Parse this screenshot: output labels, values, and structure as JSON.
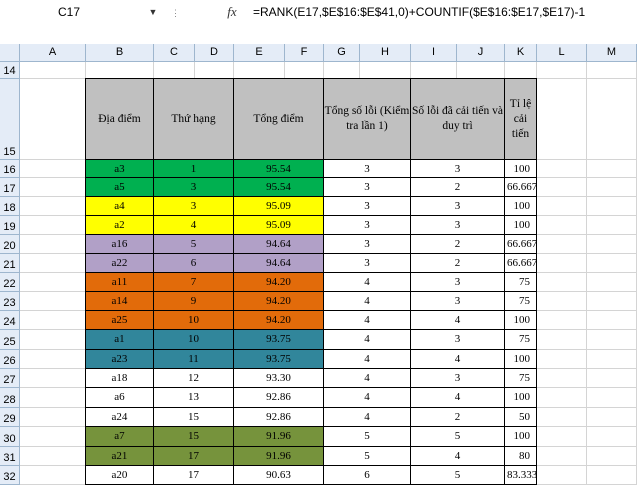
{
  "formula_bar": {
    "name_box": "C17",
    "fx_label": "fx",
    "formula": "=RANK(E17,$E$16:$E$41,0)+COUNTIF($E$16:$E17,$E17)-1"
  },
  "columns": [
    "A",
    "B",
    "C",
    "D",
    "E",
    "F",
    "G",
    "H",
    "I",
    "J",
    "K",
    "L",
    "M"
  ],
  "row_numbers": [
    "14",
    "15",
    "16",
    "17",
    "18",
    "19",
    "20",
    "21",
    "22",
    "23",
    "24",
    "25",
    "26",
    "27",
    "28",
    "29",
    "30",
    "31",
    "32"
  ],
  "table": {
    "headers": [
      "Địa điểm",
      "Thứ hạng",
      "Tổng điểm",
      "Tổng số lỗi (Kiểm tra lần 1)",
      "Số lỗi đã cải tiến và duy trì",
      "Tỉ lệ cải tiến"
    ],
    "rows": [
      {
        "location": "a3",
        "rank": "1",
        "score": "95.54",
        "errors": "3",
        "improved": "3",
        "rate": "100",
        "rate_align": "right",
        "color": "#00b050"
      },
      {
        "location": "a5",
        "rank": "3",
        "score": "95.54",
        "errors": "3",
        "improved": "2",
        "rate": "66.667",
        "rate_align": "left",
        "color": "#00b050"
      },
      {
        "location": "a4",
        "rank": "3",
        "score": "95.09",
        "errors": "3",
        "improved": "3",
        "rate": "100",
        "rate_align": "right",
        "color": "#ffff00"
      },
      {
        "location": "a2",
        "rank": "4",
        "score": "95.09",
        "errors": "3",
        "improved": "3",
        "rate": "100",
        "rate_align": "right",
        "color": "#ffff00"
      },
      {
        "location": "a16",
        "rank": "5",
        "score": "94.64",
        "errors": "3",
        "improved": "2",
        "rate": "66.667",
        "rate_align": "left",
        "color": "#b1a0c7"
      },
      {
        "location": "a22",
        "rank": "6",
        "score": "94.64",
        "errors": "3",
        "improved": "2",
        "rate": "66.667",
        "rate_align": "left",
        "color": "#b1a0c7"
      },
      {
        "location": "a11",
        "rank": "7",
        "score": "94.20",
        "errors": "4",
        "improved": "3",
        "rate": "75",
        "rate_align": "right",
        "color": "#e26b0a"
      },
      {
        "location": "a14",
        "rank": "9",
        "score": "94.20",
        "errors": "4",
        "improved": "3",
        "rate": "75",
        "rate_align": "right",
        "color": "#e26b0a"
      },
      {
        "location": "a25",
        "rank": "10",
        "score": "94.20",
        "errors": "4",
        "improved": "4",
        "rate": "100",
        "rate_align": "right",
        "color": "#e26b0a"
      },
      {
        "location": "a1",
        "rank": "10",
        "score": "93.75",
        "errors": "4",
        "improved": "3",
        "rate": "75",
        "rate_align": "right",
        "color": "#31869b"
      },
      {
        "location": "a23",
        "rank": "11",
        "score": "93.75",
        "errors": "4",
        "improved": "4",
        "rate": "100",
        "rate_align": "right",
        "color": "#31869b"
      },
      {
        "location": "a18",
        "rank": "12",
        "score": "93.30",
        "errors": "4",
        "improved": "3",
        "rate": "75",
        "rate_align": "right",
        "color": "#ffffff"
      },
      {
        "location": "a6",
        "rank": "13",
        "score": "92.86",
        "errors": "4",
        "improved": "4",
        "rate": "100",
        "rate_align": "right",
        "color": "#ffffff"
      },
      {
        "location": "a24",
        "rank": "15",
        "score": "92.86",
        "errors": "4",
        "improved": "2",
        "rate": "50",
        "rate_align": "right",
        "color": "#ffffff"
      },
      {
        "location": "a7",
        "rank": "15",
        "score": "91.96",
        "errors": "5",
        "improved": "5",
        "rate": "100",
        "rate_align": "right",
        "color": "#76933c"
      },
      {
        "location": "a21",
        "rank": "17",
        "score": "91.96",
        "errors": "5",
        "improved": "4",
        "rate": "80",
        "rate_align": "right",
        "color": "#76933c"
      },
      {
        "location": "a20",
        "rank": "17",
        "score": "90.63",
        "errors": "6",
        "improved": "5",
        "rate": "83.333",
        "rate_align": "left",
        "color": "#ffffff"
      }
    ]
  }
}
